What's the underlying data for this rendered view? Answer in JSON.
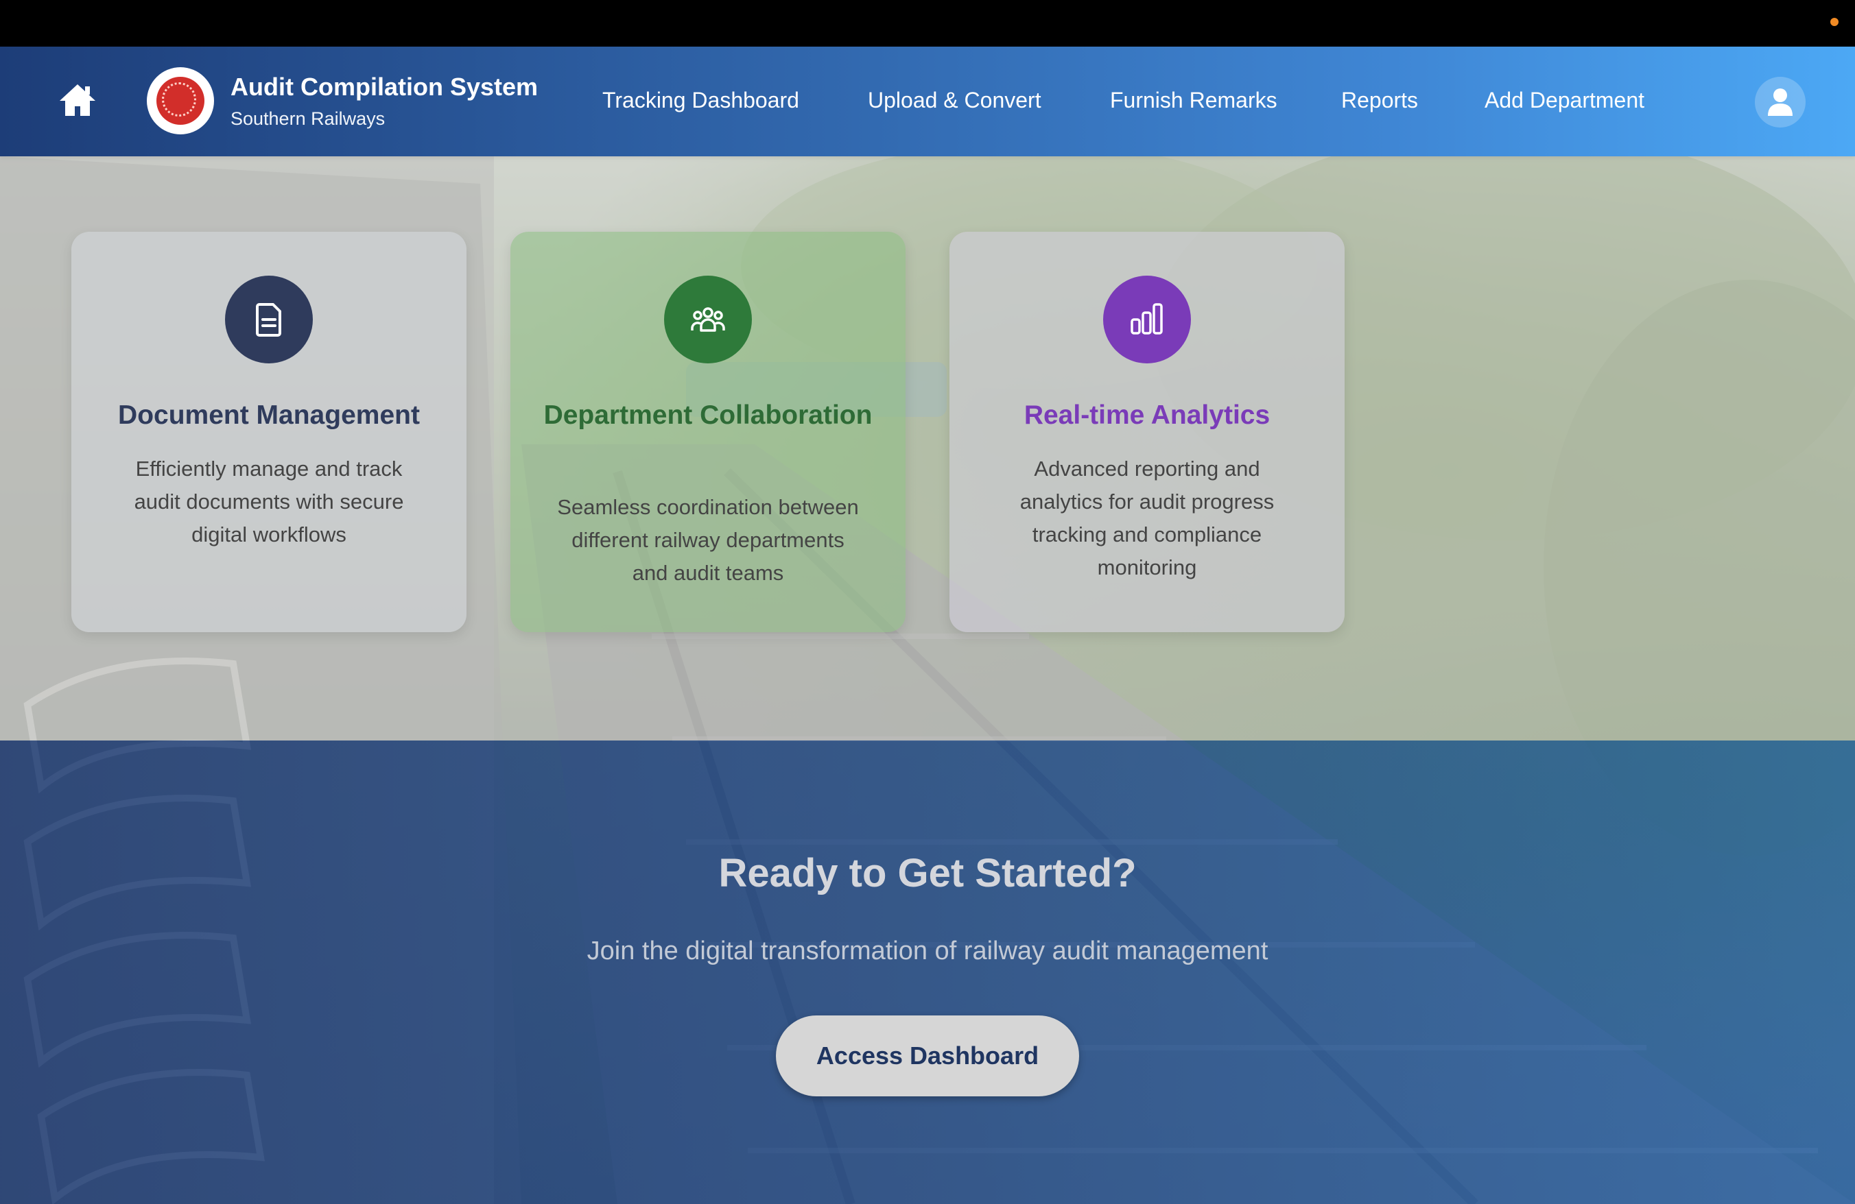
{
  "nav": {
    "home_icon": "home-icon",
    "logo": "indian-railways-emblem",
    "title": "Audit Compilation System",
    "subtitle": "Southern Railways",
    "links": [
      "Tracking Dashboard",
      "Upload & Convert",
      "Furnish Remarks",
      "Reports",
      "Add Department"
    ],
    "user_icon": "user-icon"
  },
  "features": [
    {
      "icon": "document-icon",
      "title": "Document Management",
      "description": "Efficiently manage and track audit documents with secure digital workflows",
      "accent": "#2f3b5c"
    },
    {
      "icon": "team-icon",
      "title": "Department Collaboration",
      "description": "Seamless coordination between different railway departments and audit teams",
      "accent": "#2e7a3a"
    },
    {
      "icon": "bar-chart-icon",
      "title": "Real-time Analytics",
      "description": "Advanced reporting and analytics for audit progress tracking and compliance monitoring",
      "accent": "#7a3bb8"
    }
  ],
  "cta": {
    "title": "Ready to Get Started?",
    "subtitle": "Join the digital transformation of railway audit management",
    "button": "Access Dashboard"
  }
}
